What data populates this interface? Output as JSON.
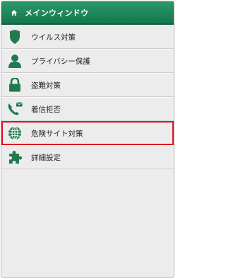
{
  "header": {
    "title": "メインウィンドウ",
    "icon": "home-icon"
  },
  "menu": {
    "items": [
      {
        "label": "ウイルス対策",
        "icon": "shield-icon"
      },
      {
        "label": "プライバシー保護",
        "icon": "person-icon"
      },
      {
        "label": "盗難対策",
        "icon": "lock-icon"
      },
      {
        "label": "着信拒否",
        "icon": "phone-mail-icon"
      },
      {
        "label": "危険サイト対策",
        "icon": "globe-icon",
        "highlighted": true
      },
      {
        "label": "詳細設定",
        "icon": "puzzle-icon"
      }
    ]
  },
  "colors": {
    "header": "#1f8a5c",
    "icon": "#1f7a4d",
    "highlight": "#e01020"
  }
}
